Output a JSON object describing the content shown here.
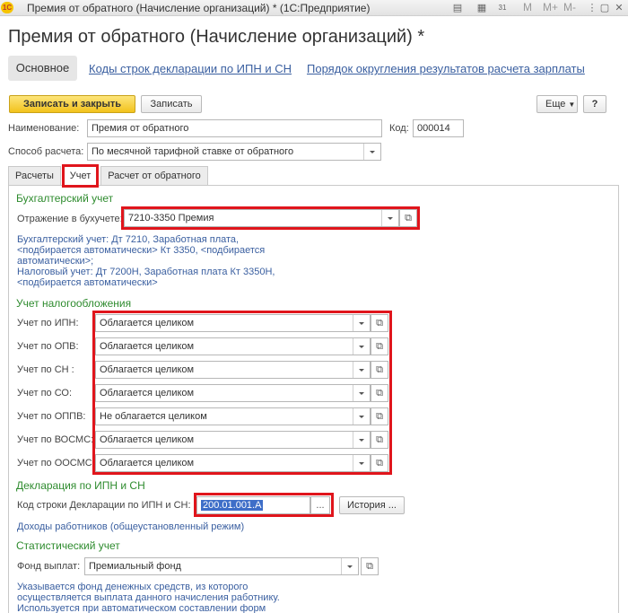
{
  "window": {
    "title": "Премия от обратного (Начисление организаций) *  (1С:Предприятие)",
    "logo_text": "1С",
    "letters": [
      "M",
      "M+",
      "M-"
    ],
    "calendar_day": "31"
  },
  "form": {
    "title": "Премия от обратного (Начисление организаций) *",
    "main_tab": "Основное",
    "nav_links": [
      "Коды строк декларации по ИПН и СН",
      "Порядок округления результатов расчета зарплаты"
    ]
  },
  "toolbar": {
    "save_close": "Записать и закрыть",
    "save": "Записать",
    "more": "Еще",
    "help": "?"
  },
  "fields": {
    "name_label": "Наименование:",
    "name_value": "Премия от обратного",
    "code_label": "Код:",
    "code_value": "000014",
    "method_label": "Способ расчета:",
    "method_value": "По месячной тарифной ставке от обратного"
  },
  "tabs": [
    "Расчеты",
    "Учет",
    "Расчет от обратного"
  ],
  "accounting": {
    "section_title": "Бухгалтерский учет",
    "reflection_label": "Отражение в бухучете:",
    "reflection_value": "7210-3350 Премия",
    "hint_lines": [
      "Бухгалтерский учет: Дт 7210, Заработная плата,",
      "<подбирается автоматически> Кт 3350, <подбирается",
      "автоматически>;",
      "Налоговый учет: Дт 7200Н, Заработная плата Кт 3350Н,",
      "<подбирается автоматически>"
    ]
  },
  "taxes": {
    "section_title": "Учет налогообложения",
    "rows": [
      {
        "label": "Учет по ИПН:",
        "value": "Облагается целиком"
      },
      {
        "label": "Учет по ОПВ:",
        "value": "Облагается целиком"
      },
      {
        "label": "Учет по СН :",
        "value": "Облагается целиком"
      },
      {
        "label": "Учет по СО:",
        "value": "Облагается целиком"
      },
      {
        "label": "Учет по ОППВ:",
        "value": "Не облагается целиком"
      },
      {
        "label": "Учет по ВОСМС:",
        "value": "Облагается целиком"
      },
      {
        "label": "Учет по ООСМС:",
        "value": "Облагается целиком"
      }
    ]
  },
  "declaration": {
    "section_title": "Декларация по ИПН и СН",
    "code_label": "Код строки Декларации по ИПН и СН:",
    "code_value": "200.01.001.А",
    "ellipsis": "...",
    "history_button": "История ...",
    "income_link": "Доходы работников (общеустановленный режим)"
  },
  "statistics": {
    "section_title": "Статистический учет",
    "fund_label": "Фонд выплат:",
    "fund_value": "Премиальный фонд",
    "hint_lines": [
      "Указывается фонд денежных средств, из которого",
      "осуществляется выплата данного начисления работнику.",
      "Используется при автоматическом составлении форм"
    ]
  },
  "colors": {
    "accent_link": "#3a5fa0",
    "section_green": "#2e8b2e",
    "highlight_red": "#e0151c",
    "primary_button": "#f2c21c"
  }
}
